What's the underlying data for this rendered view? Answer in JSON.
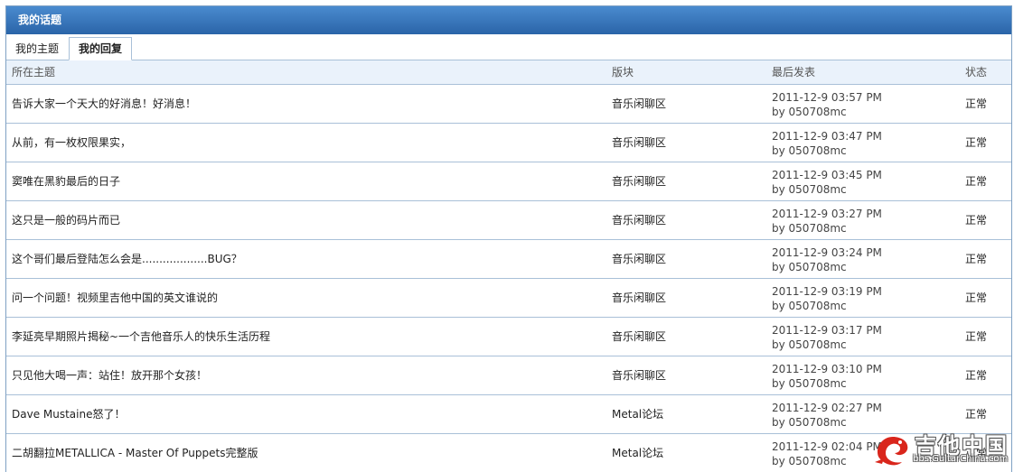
{
  "panel": {
    "title": "我的话题"
  },
  "tabs": [
    {
      "label": "我的主题",
      "active": false
    },
    {
      "label": "我的回复",
      "active": true
    }
  ],
  "columns": {
    "topic": "所在主题",
    "board": "版块",
    "last": "最后发表",
    "status": "状态"
  },
  "rows": [
    {
      "topic": "告诉大家一个天大的好消息！好消息！",
      "board": "音乐闲聊区",
      "time": "2011-12-9 03:57 PM",
      "by": "by 050708mc",
      "status": "正常"
    },
    {
      "topic": "从前，有一枚权限果实，",
      "board": "音乐闲聊区",
      "time": "2011-12-9 03:47 PM",
      "by": "by 050708mc",
      "status": "正常"
    },
    {
      "topic": "窦唯在黑豹最后的日子",
      "board": "音乐闲聊区",
      "time": "2011-12-9 03:45 PM",
      "by": "by 050708mc",
      "status": "正常"
    },
    {
      "topic": "这只是一般的码片而已",
      "board": "音乐闲聊区",
      "time": "2011-12-9 03:27 PM",
      "by": "by 050708mc",
      "status": "正常"
    },
    {
      "topic": "这个哥们最后登陆怎么会是...................BUG？",
      "board": "音乐闲聊区",
      "time": "2011-12-9 03:24 PM",
      "by": "by 050708mc",
      "status": "正常"
    },
    {
      "topic": "问一个问题！视频里吉他中国的英文谁说的",
      "board": "音乐闲聊区",
      "time": "2011-12-9 03:19 PM",
      "by": "by 050708mc",
      "status": "正常"
    },
    {
      "topic": "李延亮早期照片揭秘~一个吉他音乐人的快乐生活历程",
      "board": "音乐闲聊区",
      "time": "2011-12-9 03:17 PM",
      "by": "by 050708mc",
      "status": "正常"
    },
    {
      "topic": "只见他大喝一声：站住！放开那个女孩！",
      "board": "音乐闲聊区",
      "time": "2011-12-9 03:10 PM",
      "by": "by 050708mc",
      "status": "正常"
    },
    {
      "topic": "Dave Mustaine怒了！",
      "board": "Metal论坛",
      "time": "2011-12-9 02:27 PM",
      "by": "by 050708mc",
      "status": "正常"
    },
    {
      "topic": "二胡翻拉METALLICA - Master Of Puppets完整版",
      "board": "Metal论坛",
      "time": "2011-12-9 02:04 PM",
      "by": "by 050708mc",
      "status": "正常"
    }
  ],
  "watermark": {
    "name": "吉他中国",
    "url": "bbs.GuitarChina.com"
  },
  "colors": {
    "header": "#2a64a8",
    "border": "#a9c0d8",
    "colhead_bg": "#eaf2fb"
  }
}
